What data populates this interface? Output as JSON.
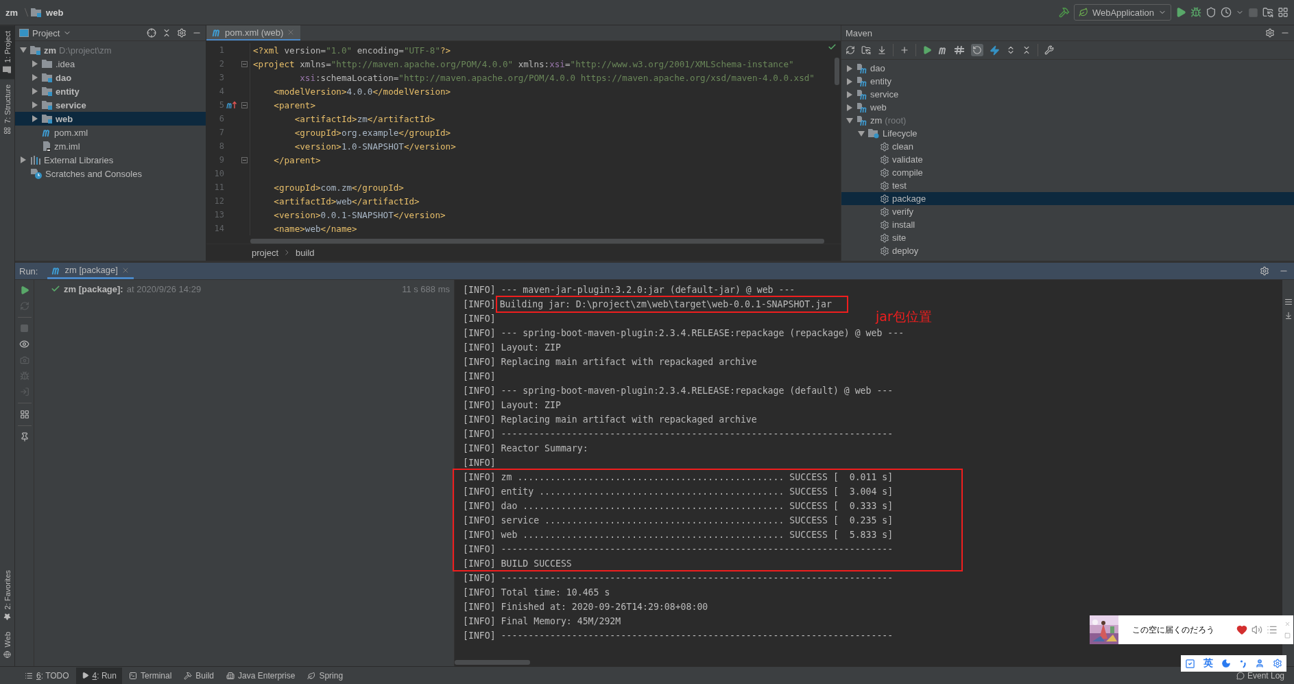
{
  "breadcrumb": [
    {
      "kind": "plain",
      "label": "zm"
    },
    {
      "kind": "module",
      "label": "web"
    }
  ],
  "run_config": {
    "label": "WebApplication"
  },
  "tool_stripe": {
    "top": [
      {
        "label": "1: Project",
        "kind": "project",
        "selected": true
      },
      {
        "label": "7: Structure",
        "kind": "structure",
        "selected": false
      }
    ],
    "bottom": [
      {
        "label": "2: Favorites",
        "kind": "favorites",
        "selected": false
      },
      {
        "label": "Web",
        "kind": "web",
        "selected": false
      }
    ]
  },
  "project_panel": {
    "title": "Project",
    "tree": [
      {
        "label": "zm",
        "path": "D:\\project\\zm",
        "kind": "module",
        "expanded": true,
        "selected": false,
        "children": [
          {
            "label": ".idea",
            "kind": "folder",
            "expanded": false,
            "selected": false
          },
          {
            "label": "dao",
            "kind": "module",
            "expanded": false,
            "selected": false
          },
          {
            "label": "entity",
            "kind": "module",
            "expanded": false,
            "selected": false
          },
          {
            "label": "service",
            "kind": "module",
            "expanded": false,
            "selected": false
          },
          {
            "label": "web",
            "kind": "module",
            "expanded": false,
            "selected": true
          },
          {
            "label": "pom.xml",
            "kind": "maven",
            "selected": false
          },
          {
            "label": "zm.iml",
            "kind": "iml",
            "selected": false
          }
        ]
      },
      {
        "label": "External Libraries",
        "kind": "libraries",
        "expanded": false,
        "selected": false
      },
      {
        "label": "Scratches and Consoles",
        "kind": "scratches",
        "selected": false
      }
    ]
  },
  "editor": {
    "tab": {
      "label": "pom.xml (web)",
      "selected": true
    },
    "lines": [
      {
        "number": "1",
        "fold": false,
        "gutter_icon": false,
        "segments": [
          {
            "kind": "tag",
            "text": "<?xml "
          },
          {
            "kind": "attr",
            "text": "version="
          },
          {
            "kind": "value",
            "text": "\"1.0\""
          },
          {
            "kind": "attr",
            "text": " encoding="
          },
          {
            "kind": "value",
            "text": "\"UTF-8\""
          },
          {
            "kind": "tag",
            "text": "?>"
          }
        ]
      },
      {
        "number": "2",
        "fold": true,
        "gutter_icon": false,
        "segments": [
          {
            "kind": "tag",
            "text": "<project"
          },
          {
            "kind": "attr",
            "text": " xmlns="
          },
          {
            "kind": "value",
            "text": "\"http://maven.apache.org/POM/4.0.0\""
          },
          {
            "kind": "attr",
            "text": " xmlns:"
          },
          {
            "kind": "ns",
            "text": "xsi"
          },
          {
            "kind": "attr",
            "text": "="
          },
          {
            "kind": "value",
            "text": "\"http://www.w3.org/2001/XMLSchema-instance\""
          }
        ]
      },
      {
        "number": "3",
        "fold": false,
        "gutter_icon": false,
        "segments": [
          {
            "kind": "ns",
            "text": "         xsi"
          },
          {
            "kind": "attr",
            "text": ":schemaLocation="
          },
          {
            "kind": "value",
            "text": "\"http://maven.apache.org/POM/4.0.0 https://maven.apache.org/xsd/maven-4.0.0.xsd\""
          }
        ]
      },
      {
        "number": "4",
        "fold": false,
        "gutter_icon": false,
        "segments": [
          {
            "kind": "tag",
            "text": "    <modelVersion>"
          },
          {
            "kind": "text",
            "text": "4.0.0"
          },
          {
            "kind": "tag",
            "text": "</modelVersion>"
          }
        ]
      },
      {
        "number": "5",
        "fold": true,
        "gutter_icon": true,
        "segments": [
          {
            "kind": "tag",
            "text": "    <parent>"
          }
        ]
      },
      {
        "number": "6",
        "fold": false,
        "gutter_icon": false,
        "segments": [
          {
            "kind": "tag",
            "text": "        <artifactId>"
          },
          {
            "kind": "text",
            "text": "zm"
          },
          {
            "kind": "tag",
            "text": "</artifactId>"
          }
        ]
      },
      {
        "number": "7",
        "fold": false,
        "gutter_icon": false,
        "segments": [
          {
            "kind": "tag",
            "text": "        <groupId>"
          },
          {
            "kind": "text",
            "text": "org.example"
          },
          {
            "kind": "tag",
            "text": "</groupId>"
          }
        ]
      },
      {
        "number": "8",
        "fold": false,
        "gutter_icon": false,
        "segments": [
          {
            "kind": "tag",
            "text": "        <version>"
          },
          {
            "kind": "text",
            "text": "1.0-SNAPSHOT"
          },
          {
            "kind": "tag",
            "text": "</version>"
          }
        ]
      },
      {
        "number": "9",
        "fold": true,
        "gutter_icon": false,
        "segments": [
          {
            "kind": "tag",
            "text": "    </parent>"
          }
        ]
      },
      {
        "number": "10",
        "fold": false,
        "gutter_icon": false
      },
      {
        "number": "11",
        "fold": false,
        "gutter_icon": false,
        "segments": [
          {
            "kind": "tag",
            "text": "    <groupId>"
          },
          {
            "kind": "text",
            "text": "com.zm"
          },
          {
            "kind": "tag",
            "text": "</groupId>"
          }
        ]
      },
      {
        "number": "12",
        "fold": false,
        "gutter_icon": false,
        "segments": [
          {
            "kind": "tag",
            "text": "    <artifactId>"
          },
          {
            "kind": "text",
            "text": "web"
          },
          {
            "kind": "tag",
            "text": "</artifactId>"
          }
        ]
      },
      {
        "number": "13",
        "fold": false,
        "gutter_icon": false,
        "segments": [
          {
            "kind": "tag",
            "text": "    <version>"
          },
          {
            "kind": "text",
            "text": "0.0.1-SNAPSHOT"
          },
          {
            "kind": "tag",
            "text": "</version>"
          }
        ]
      },
      {
        "number": "14",
        "fold": false,
        "gutter_icon": false,
        "segments": [
          {
            "kind": "tag",
            "text": "    <name>"
          },
          {
            "kind": "text",
            "text": "web"
          },
          {
            "kind": "tag",
            "text": "</name>"
          }
        ]
      }
    ],
    "breadcrumb": [
      "project",
      "build"
    ]
  },
  "maven": {
    "title": "Maven",
    "tree": [
      {
        "label": "dao",
        "kind": "module",
        "expanded": false,
        "selected": false
      },
      {
        "label": "entity",
        "kind": "module",
        "expanded": false,
        "selected": false
      },
      {
        "label": "service",
        "kind": "module",
        "expanded": false,
        "selected": false
      },
      {
        "label": "web",
        "kind": "module",
        "expanded": false,
        "selected": false
      },
      {
        "label": "zm",
        "note": "(root)",
        "kind": "module",
        "expanded": true,
        "selected": false,
        "children": [
          {
            "label": "Lifecycle",
            "kind": "lifecycle",
            "expanded": true,
            "selected": false,
            "children": [
              {
                "label": "clean",
                "kind": "goal",
                "selected": false
              },
              {
                "label": "validate",
                "kind": "goal",
                "selected": false
              },
              {
                "label": "compile",
                "kind": "goal",
                "selected": false
              },
              {
                "label": "test",
                "kind": "goal",
                "selected": false
              },
              {
                "label": "package",
                "kind": "goal",
                "selected": true
              },
              {
                "label": "verify",
                "kind": "goal",
                "selected": false
              },
              {
                "label": "install",
                "kind": "goal",
                "selected": false
              },
              {
                "label": "site",
                "kind": "goal",
                "selected": false
              },
              {
                "label": "deploy",
                "kind": "goal",
                "selected": false
              }
            ]
          }
        ]
      }
    ]
  },
  "run": {
    "label": "Run:",
    "tab": {
      "label": "zm [package]",
      "selected": true
    },
    "result": {
      "name": "zm [package]:",
      "time": "at 2020/9/26 14:29",
      "duration": "11 s 688 ms"
    },
    "console": [
      {
        "level": "[INFO]",
        "message": "--- maven-jar-plugin:3.2.0:jar (default-jar) @ web ---"
      },
      {
        "level": "[INFO]",
        "message": "Building jar: D:\\project\\zm\\web\\target\\web-0.0.1-SNAPSHOT.jar",
        "boxed": true
      },
      {
        "level": "[INFO]"
      },
      {
        "level": "[INFO]",
        "message": "--- spring-boot-maven-plugin:2.3.4.RELEASE:repackage (repackage) @ web ---"
      },
      {
        "level": "[INFO]",
        "message": "Layout: ZIP"
      },
      {
        "level": "[INFO]",
        "message": "Replacing main artifact with repackaged archive"
      },
      {
        "level": "[INFO]"
      },
      {
        "level": "[INFO]",
        "message": "--- spring-boot-maven-plugin:2.3.4.RELEASE:repackage (default) @ web ---"
      },
      {
        "level": "[INFO]",
        "message": "Layout: ZIP"
      },
      {
        "level": "[INFO]",
        "message": "Replacing main artifact with repackaged archive"
      },
      {
        "level": "[INFO]",
        "message": "------------------------------------------------------------------------"
      },
      {
        "level": "[INFO]",
        "message": "Reactor Summary:"
      },
      {
        "level": "[INFO]"
      },
      {
        "level": "[INFO]",
        "message": "zm ................................................. SUCCESS [  0.011 s]"
      },
      {
        "level": "[INFO]",
        "message": "entity ............................................. SUCCESS [  3.004 s]"
      },
      {
        "level": "[INFO]",
        "message": "dao ................................................ SUCCESS [  0.333 s]"
      },
      {
        "level": "[INFO]",
        "message": "service ............................................ SUCCESS [  0.235 s]"
      },
      {
        "level": "[INFO]",
        "message": "web ................................................ SUCCESS [  5.833 s]"
      },
      {
        "level": "[INFO]",
        "message": "------------------------------------------------------------------------"
      },
      {
        "level": "[INFO]",
        "message": "BUILD SUCCESS"
      },
      {
        "level": "[INFO]",
        "message": "------------------------------------------------------------------------"
      },
      {
        "level": "[INFO]",
        "message": "Total time: 10.465 s"
      },
      {
        "level": "[INFO]",
        "message": "Finished at: 2020-09-26T14:29:08+08:00"
      },
      {
        "level": "[INFO]",
        "message": "Final Memory: 45M/292M"
      },
      {
        "level": "[INFO]",
        "message": "------------------------------------------------------------------------"
      }
    ]
  },
  "annotation": {
    "label": "jar包位置"
  },
  "status_bar": {
    "tabs": [
      {
        "key": "6",
        "label": ": TODO",
        "kind": "todo",
        "selected": false
      },
      {
        "key": "4",
        "label": ": Run",
        "kind": "run",
        "selected": true
      },
      {
        "label": "Terminal",
        "kind": "terminal",
        "selected": false
      },
      {
        "label": "Build",
        "kind": "build",
        "selected": false
      },
      {
        "label": "Java Enterprise",
        "kind": "enterprise",
        "selected": false
      },
      {
        "label": "Spring",
        "kind": "spring",
        "selected": false
      }
    ],
    "event_log": "Event Log"
  },
  "music_player": {
    "title": "この空に届くのだろう",
    "liked": true
  },
  "ime_bar": {
    "mode": "英"
  }
}
